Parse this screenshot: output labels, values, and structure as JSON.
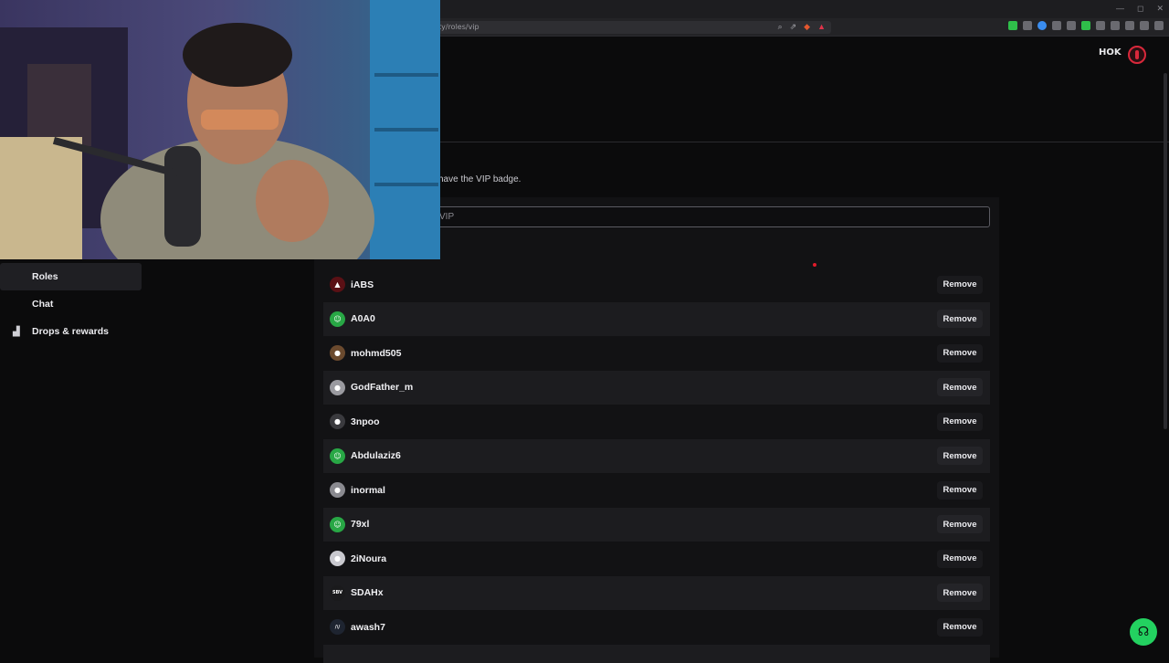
{
  "browser": {
    "url": "ty/roles/vip",
    "window_controls": [
      "—",
      "◻",
      "✕"
    ]
  },
  "header": {
    "icon_text": "HOK"
  },
  "page": {
    "description": "have the VIP badge.",
    "search_value": "VIP"
  },
  "sidebar": {
    "items": [
      {
        "label": "Roles",
        "active": true
      },
      {
        "label": "Chat",
        "active": false
      },
      {
        "label": "Drops & rewards",
        "active": false,
        "icon": "gift-icon"
      }
    ]
  },
  "vip_list": {
    "remove_label": "Remove",
    "users": [
      {
        "name": "iABS",
        "avatar": "▲",
        "avatar_color": "#5a1015"
      },
      {
        "name": "A0A0",
        "avatar": "☺",
        "avatar_color": "#28a745"
      },
      {
        "name": "mohmd505",
        "avatar": "●",
        "avatar_color": "#6b4a2e"
      },
      {
        "name": "GodFather_m",
        "avatar": "●",
        "avatar_color": "#9a9aa0"
      },
      {
        "name": "3npoo",
        "avatar": "●",
        "avatar_color": "#3a3a3e"
      },
      {
        "name": "Abdulaziz6",
        "avatar": "☺",
        "avatar_color": "#28a745"
      },
      {
        "name": "inormal",
        "avatar": "●",
        "avatar_color": "#8a8a90"
      },
      {
        "name": "79xl",
        "avatar": "☺",
        "avatar_color": "#28a745"
      },
      {
        "name": "2iNoura",
        "avatar": "●",
        "avatar_color": "#c9c9cf"
      },
      {
        "name": "SDAHx",
        "avatar": "SBV",
        "avatar_color": "#1a1a1c"
      },
      {
        "name": "awash7",
        "avatar": "/\\/",
        "avatar_color": "#1e2430"
      }
    ]
  },
  "colors": {
    "accent_green": "#23d160",
    "accent_red": "#d9283b"
  }
}
